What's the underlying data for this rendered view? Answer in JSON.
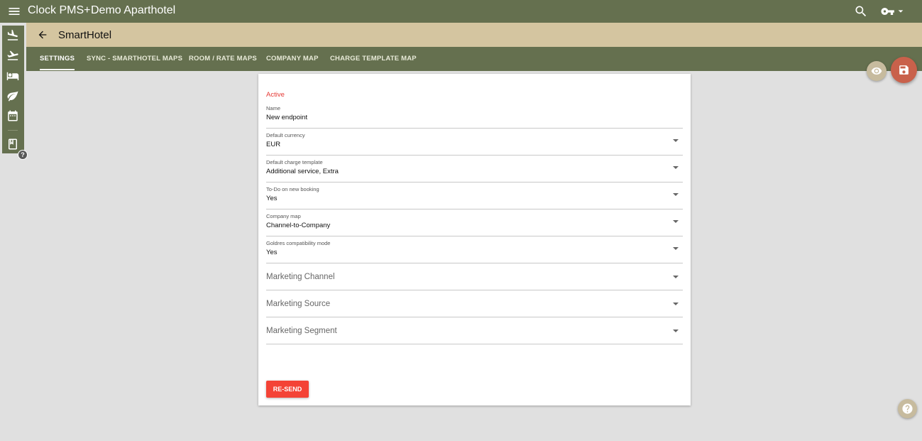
{
  "app": {
    "brand": "Clock PMS+",
    "hotel": "Demo Aparthotel"
  },
  "header": {
    "title": "SmartHotel"
  },
  "tabs": [
    {
      "label": "SETTINGS"
    },
    {
      "label": "SYNC - SMARTHOTEL MAPS"
    },
    {
      "label": "ROOM / RATE MAPS"
    },
    {
      "label": "COMPANY MAP"
    },
    {
      "label": "CHARGE TEMPLATE MAP"
    }
  ],
  "sidenav": [
    "arrivals-icon",
    "departures-icon",
    "bed-icon",
    "leaf-icon",
    "calendar-icon",
    "book-icon"
  ],
  "form": {
    "status": "Active",
    "name": {
      "label": "Name",
      "value": "New endpoint"
    },
    "currency": {
      "label": "Default currency",
      "value": "EUR"
    },
    "charge_template": {
      "label": "Default charge template",
      "value": "Additional service, Extra"
    },
    "todo": {
      "label": "To-Do on new booking",
      "value": "Yes"
    },
    "company_map": {
      "label": "Company map",
      "value": "Channel-to-Company"
    },
    "goldres": {
      "label": "Goldres compatibility mode",
      "value": "Yes"
    },
    "marketing_channel": {
      "placeholder": "Marketing Channel"
    },
    "marketing_source": {
      "placeholder": "Marketing Source"
    },
    "marketing_segment": {
      "placeholder": "Marketing Segment"
    },
    "resend_label": "RE-SEND"
  },
  "colors": {
    "topbar": "#65704f",
    "subheader": "#d4c5a0",
    "accent_red": "#f44336",
    "save_fab": "#c9614b"
  }
}
